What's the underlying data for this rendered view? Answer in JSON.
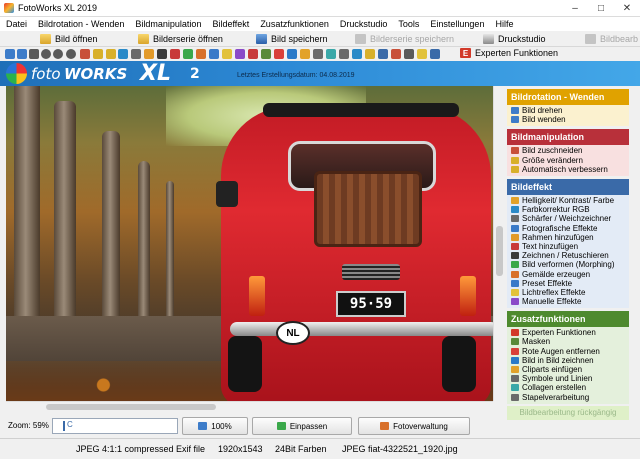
{
  "window": {
    "title": "FotoWorks XL 2019",
    "min_glyph": "–",
    "max_glyph": "□",
    "close_glyph": "✕"
  },
  "menu": [
    {
      "label": "Datei"
    },
    {
      "label": "Bildrotation - Wenden"
    },
    {
      "label": "Bildmanipulation"
    },
    {
      "label": "Bildeffekt"
    },
    {
      "label": "Zusatzfunktionen"
    },
    {
      "label": "Druckstudio"
    },
    {
      "label": "Tools"
    },
    {
      "label": "Einstellungen"
    },
    {
      "label": "Hilfe"
    }
  ],
  "actions": {
    "open_image": "Bild öffnen",
    "open_series": "Bilderserie öffnen",
    "save_image": "Bild speichern",
    "save_series": "Bilderserie speichern",
    "print_studio": "Druckstudio",
    "expert": "Experten Funktionen",
    "image_edit": "Bildbearb"
  },
  "header": {
    "logo_foto": "foto",
    "logo_works": "WORKS",
    "logo_xl": "XL",
    "logo_version": "2",
    "last_date": "Letztes Erstellungsdatum: 04.08.2019"
  },
  "photo": {
    "plate": "95·59",
    "badge": "NL"
  },
  "panel": {
    "sections": [
      {
        "title": "Bildrotation - Wenden",
        "items": [
          "Bild drehen",
          "Bild wenden"
        ]
      },
      {
        "title": "Bildmanipulation",
        "items": [
          "Bild zuschneiden",
          "Größe verändern",
          "Automatisch verbessern"
        ]
      },
      {
        "title": "Bildeffekt",
        "items": [
          "Helligkeit/ Kontrast/ Farbe",
          "Farbkorrektur RGB",
          "Schärfer / Weichzeichner",
          "Fotografische Effekte",
          "Rahmen hinzufügen",
          "Text hinzufügen",
          "Zeichnen / Retuschieren",
          "Bild verformen (Morphing)",
          "Gemälde erzeugen",
          "Preset Effekte",
          "Lichtreflex Effekte",
          "Manuelle Effekte"
        ]
      },
      {
        "title": "Zusatzfunktionen",
        "items": [
          "Experten Funktionen",
          "Masken",
          "Rote Augen entfernen",
          "Bild in Bild zeichnen",
          "Cliparts einfügen",
          "Symbole und Linien",
          "Collagen erstellen",
          "Stapelverarbeitung"
        ]
      }
    ],
    "footer": "Bildbearbeitung rückgängig"
  },
  "zoom": {
    "label": "Zoom: 59%",
    "slider_char": "C",
    "btn_100": "100%",
    "btn_fit": "Einpassen",
    "btn_manager": "Fotoverwaltung"
  },
  "status": {
    "format": "JPEG 4:1:1 compressed Exif file",
    "dimensions": "1920x1543",
    "colors": "24Bit Farben",
    "filename": "JPEG fiat-4322521_1920.jpg"
  },
  "colors": {
    "accent_blue": "#2d8ad6",
    "rotation": "#e0a200",
    "manipulation": "#b8303a",
    "effect": "#3a6aa8",
    "extra": "#4e8a2e"
  }
}
